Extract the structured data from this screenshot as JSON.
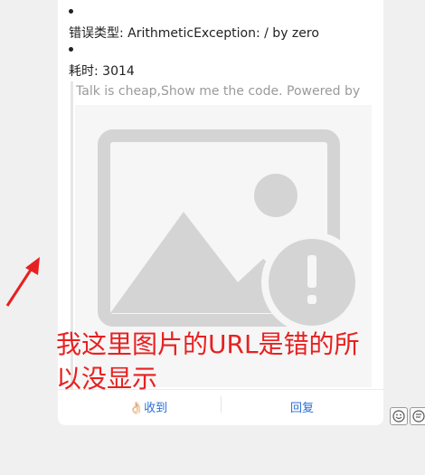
{
  "message": {
    "error_type_line": "错误类型: ArithmeticException: / by zero",
    "elapsed_line": "耗时: 3014",
    "quote_text": "Talk is cheap,Show me the code. Powered by"
  },
  "footer": {
    "received_label": "👌🏻收到",
    "reply_label": "回复"
  },
  "annotation": {
    "text": "我这里图片的URL是错的所以没显示"
  },
  "icons": {
    "broken_image": "broken-image-icon",
    "emoji": "emoji-icon",
    "more": "more-icon"
  },
  "colors": {
    "annotation": "#e82020",
    "link": "#2a6fd6"
  }
}
